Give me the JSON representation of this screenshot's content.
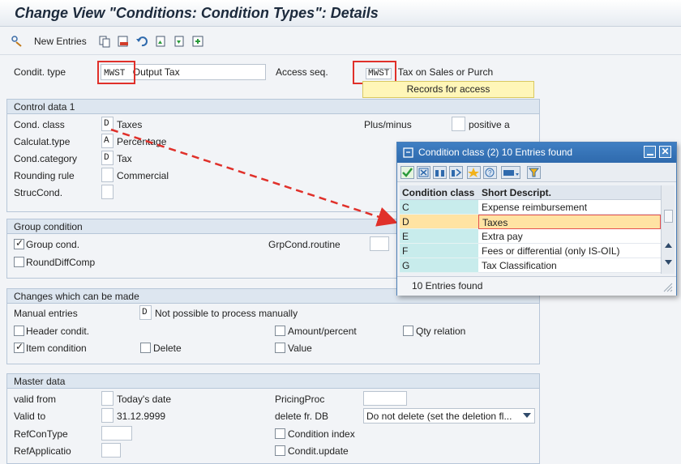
{
  "window": {
    "title": "Change View \"Conditions: Condition Types\": Details"
  },
  "toolbar": {
    "new_entries": "New Entries"
  },
  "header": {
    "cond_type_label": "Condit. type",
    "cond_type_code": "MWST",
    "cond_type_name": "Output Tax",
    "access_seq_label": "Access seq.",
    "access_seq_code": "MWST",
    "access_seq_name": "Tax on Sales or Purch",
    "records_button": "Records for access"
  },
  "control": {
    "title": "Control data 1",
    "cond_class_label": "Cond. class",
    "cond_class_code": "D",
    "cond_class_text": "Taxes",
    "calc_type_label": "Calculat.type",
    "calc_type_code": "A",
    "calc_type_text": "Percentage",
    "cond_cat_label": "Cond.category",
    "cond_cat_code": "D",
    "cond_cat_text": "Tax",
    "rounding_label": "Rounding rule",
    "rounding_text": "Commercial",
    "struc_label": "StrucCond.",
    "plusminus_label": "Plus/minus",
    "plusminus_text": "positive a"
  },
  "group": {
    "title": "Group condition",
    "group_cond": "Group cond.",
    "round_diff": "RoundDiffComp",
    "routine_label": "GrpCond.routine"
  },
  "changes": {
    "title": "Changes which can be made",
    "manual_label": "Manual entries",
    "manual_code": "D",
    "manual_text": "Not possible to process manually",
    "header_condit": "Header condit.",
    "item_condition": "Item condition",
    "delete": "Delete",
    "amount_percent": "Amount/percent",
    "value": "Value",
    "qty_relation": "Qty relation"
  },
  "master": {
    "title": "Master data",
    "valid_from_label": "valid from",
    "valid_from_text": "Today's date",
    "valid_to_label": "Valid to",
    "valid_to_value": "31.12.9999",
    "refcon_label": "RefConType",
    "refapp_label": "RefApplicatio",
    "pricing_label": "PricingProc",
    "delete_label": "delete fr. DB",
    "delete_value": "Do not delete (set the deletion fl...",
    "cond_index": "Condition index",
    "condit_update": "Condit.update"
  },
  "popup": {
    "title": "Condition class (2)   10 Entries found",
    "col1": "Condition class",
    "col2": "Short Descript.",
    "rows": [
      {
        "code": "C",
        "desc": "Expense reimbursement"
      },
      {
        "code": "D",
        "desc": "Taxes"
      },
      {
        "code": "E",
        "desc": "Extra pay"
      },
      {
        "code": "F",
        "desc": "Fees or differential (only IS-OIL)"
      },
      {
        "code": "G",
        "desc": "Tax Classification"
      }
    ],
    "footer": "10 Entries found"
  },
  "colors": {
    "accent": "#2f6aad",
    "highlight": "#ffe3a3",
    "annotation": "#e0302a"
  }
}
